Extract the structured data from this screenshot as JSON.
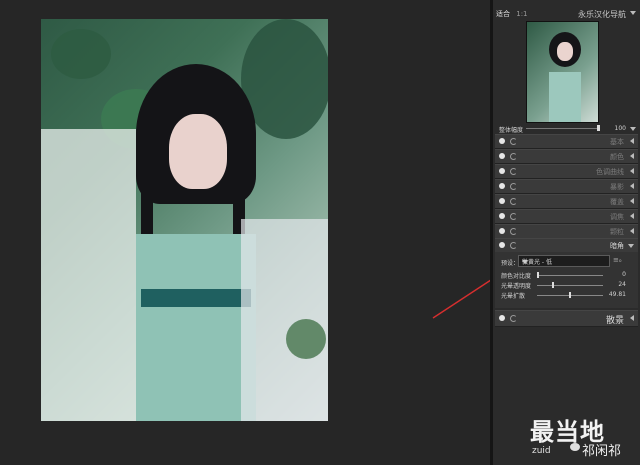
{
  "navigator": {
    "zoom_fit": "适合",
    "zoom_ratio": "1:1",
    "title": "永乐汉化导航"
  },
  "master": {
    "label": "整体幅度",
    "value": "100"
  },
  "sections": [
    {
      "label": "基本",
      "expanded": false
    },
    {
      "label": "颜色",
      "expanded": false
    },
    {
      "label": "色调曲线",
      "expanded": false
    },
    {
      "label": "暴影",
      "expanded": false
    },
    {
      "label": "覆盖",
      "expanded": false
    },
    {
      "label": "调焦",
      "expanded": false
    },
    {
      "label": "颗粒",
      "expanded": false
    },
    {
      "label": "暗角",
      "expanded": true
    }
  ],
  "vignette": {
    "preset_label": "预设：",
    "preset_value": "微黄光 - 低",
    "preset_extra": "≡ₒ",
    "sliders": [
      {
        "label": "颜色对比度",
        "value": "0",
        "fraction": 0.0
      },
      {
        "label": "光晕透明度",
        "value": "24",
        "fraction": 0.24
      },
      {
        "label": "光晕扩散",
        "value": "49.81",
        "fraction": 0.5
      }
    ]
  },
  "bottom_section": {
    "label": "散景"
  },
  "watermark": {
    "big": "最当地",
    "small": "zuid",
    "handle": "祁闲祁"
  },
  "colors": {
    "arrow": "#d62e2e",
    "panel": "#2b2b2b",
    "section": "#3a3a3a"
  }
}
